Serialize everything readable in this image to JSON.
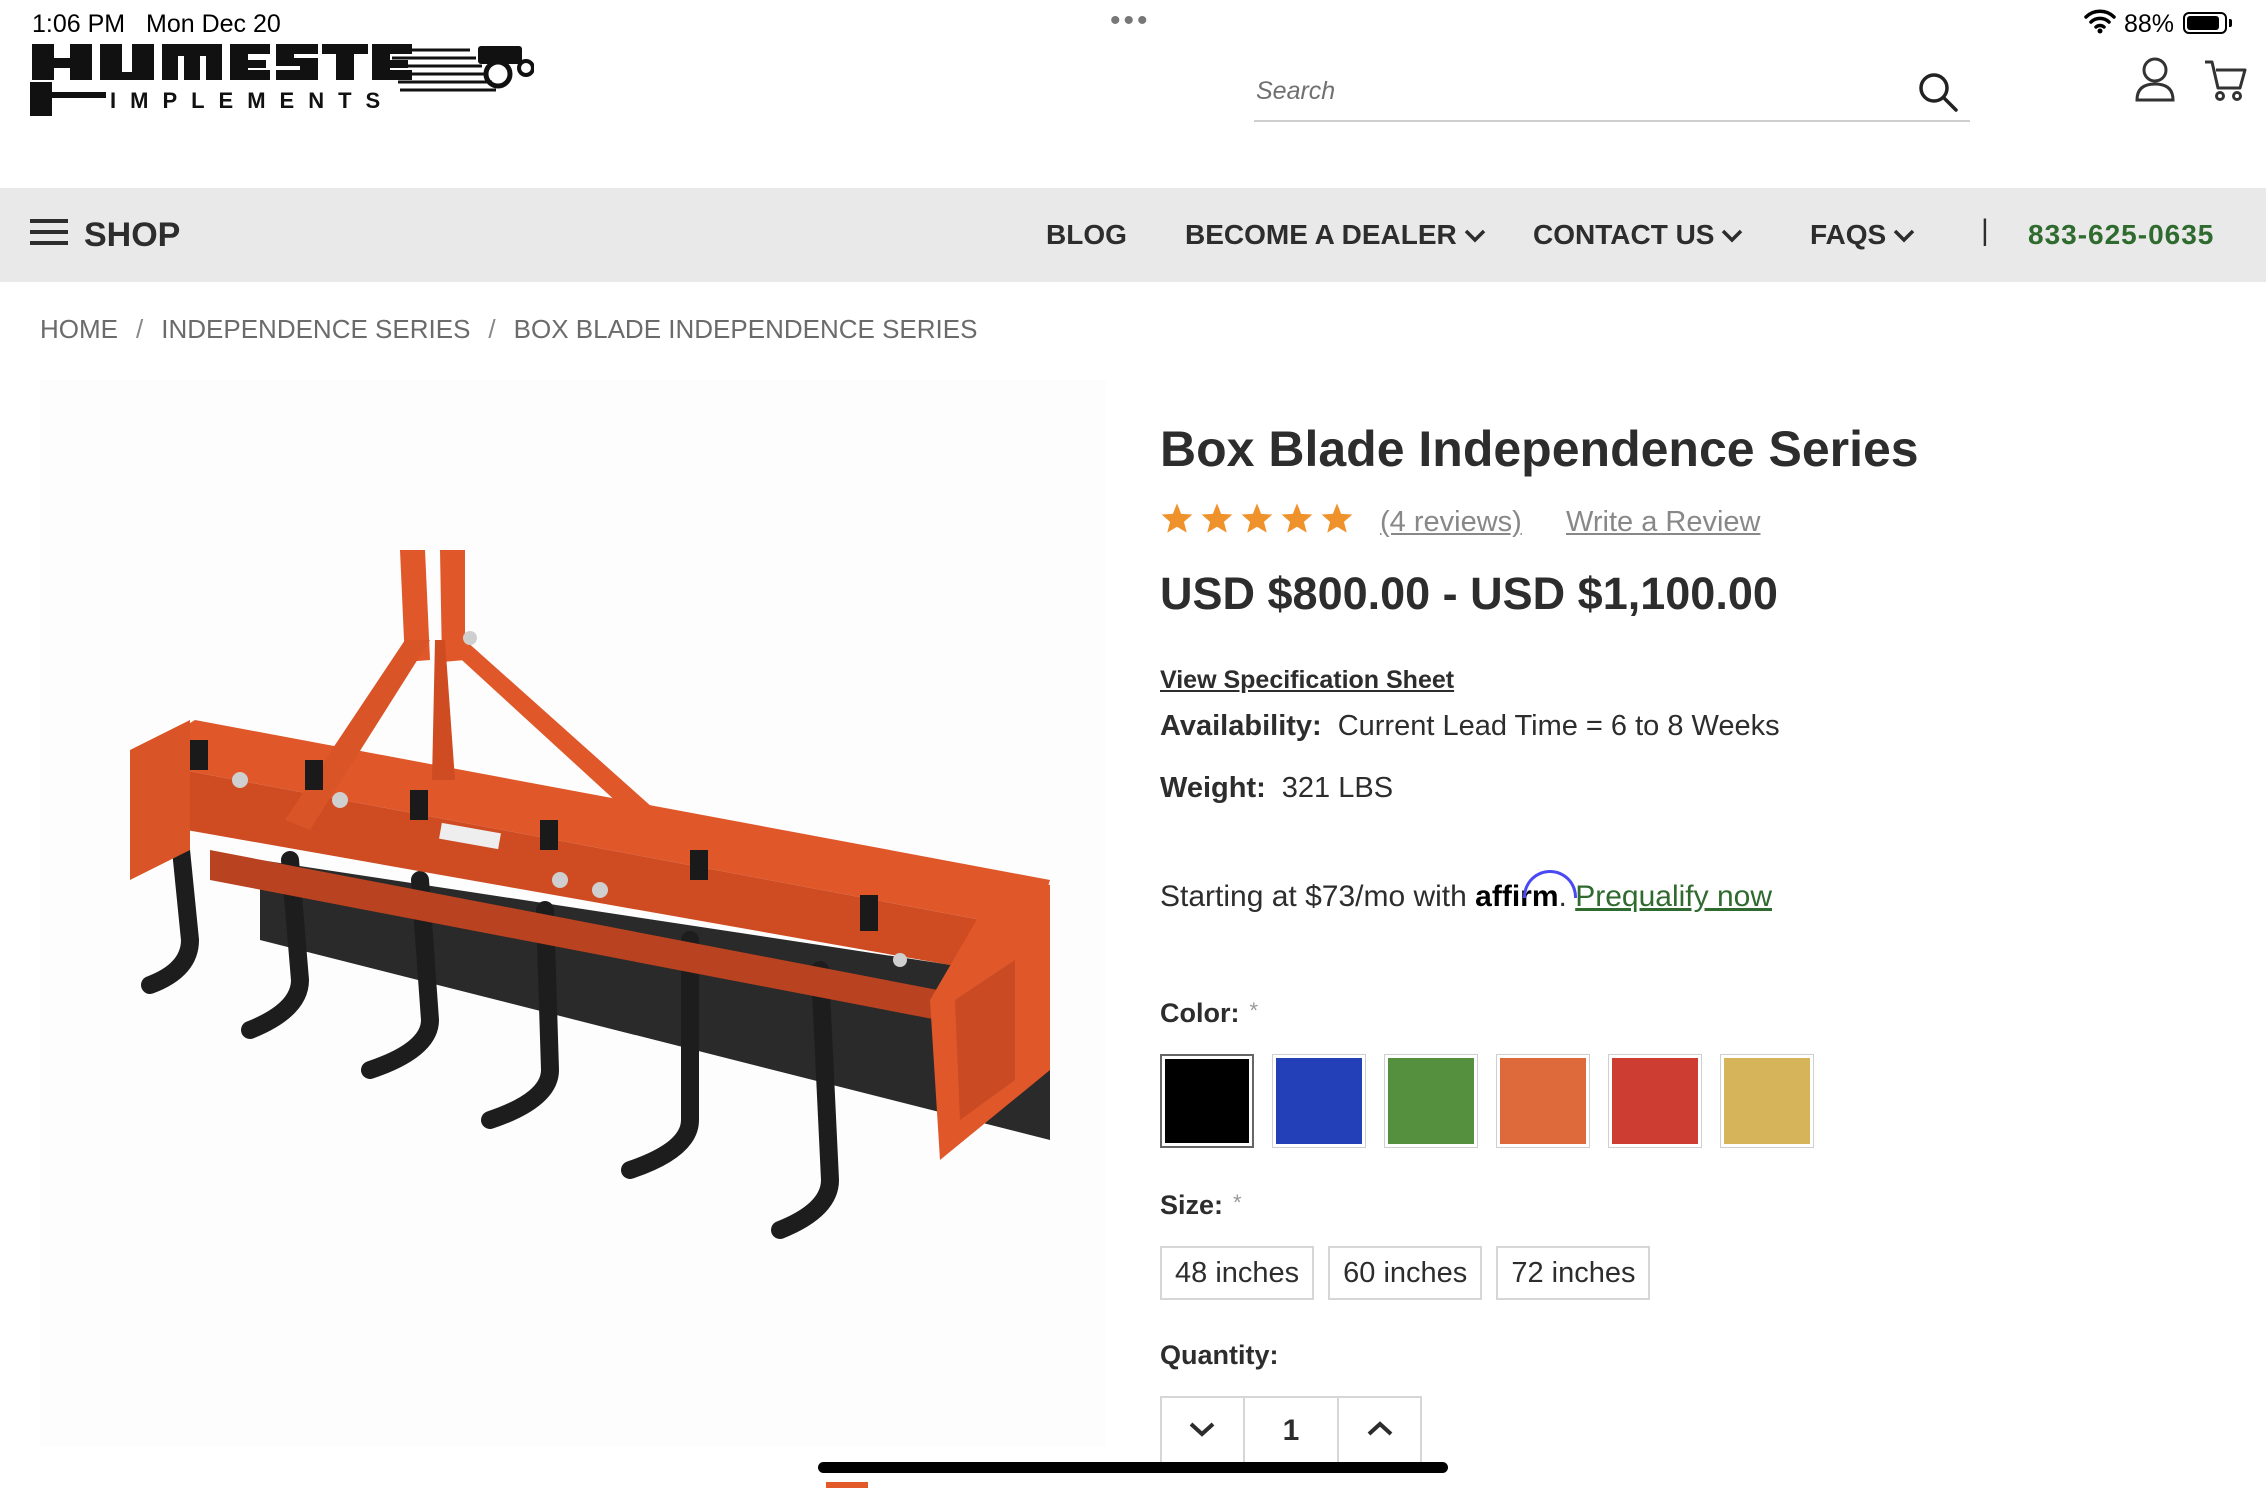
{
  "status_bar": {
    "time": "1:06 PM",
    "date": "Mon Dec 20",
    "battery_percent": "88%",
    "battery_level": 0.88,
    "dots": "•••"
  },
  "header": {
    "logo_icon": "homestead-implements-logo",
    "search": {
      "placeholder": "Search"
    },
    "icons": [
      "user-icon",
      "cart-icon",
      "search-icon"
    ]
  },
  "nav": {
    "shop_label": "SHOP",
    "items": [
      {
        "label": "BLOG",
        "has_dropdown": false
      },
      {
        "label": "BECOME A DEALER",
        "has_dropdown": true
      },
      {
        "label": "CONTACT US",
        "has_dropdown": true
      },
      {
        "label": "FAQS",
        "has_dropdown": true
      }
    ],
    "separator": "|",
    "phone": "833-625-0635",
    "phone_color": "#2f6a2f"
  },
  "breadcrumb": [
    "HOME",
    "INDEPENDENCE SERIES",
    "BOX BLADE INDEPENDENCE SERIES"
  ],
  "product": {
    "title": "Box Blade Independence Series",
    "rating": 5,
    "reviews_link": "(4 reviews)",
    "write_review": "Write a Review",
    "price": "USD $800.00 - USD $1,100.00",
    "spec_sheet_link": "View Specification Sheet",
    "availability_label": "Availability:",
    "availability_value": "Current Lead Time = 6 to 8 Weeks",
    "weight_label": "Weight:",
    "weight_value": "321 LBS",
    "affirm": {
      "prefix": "Starting at $73/mo with",
      "brand": "affirm",
      "suffix": ".",
      "link": "Prequalify now"
    },
    "color_label": "Color:",
    "required_mark": "*",
    "colors": [
      "#000000",
      "#2340b8",
      "#55903e",
      "#de6a3c",
      "#cd3d31",
      "#d5b45a"
    ],
    "size_label": "Size:",
    "sizes": [
      "48 inches",
      "60 inches",
      "72 inches"
    ],
    "quantity_label": "Quantity:",
    "quantity": "1",
    "star_color": "#f0922b",
    "implement_color": "#e0572a"
  }
}
